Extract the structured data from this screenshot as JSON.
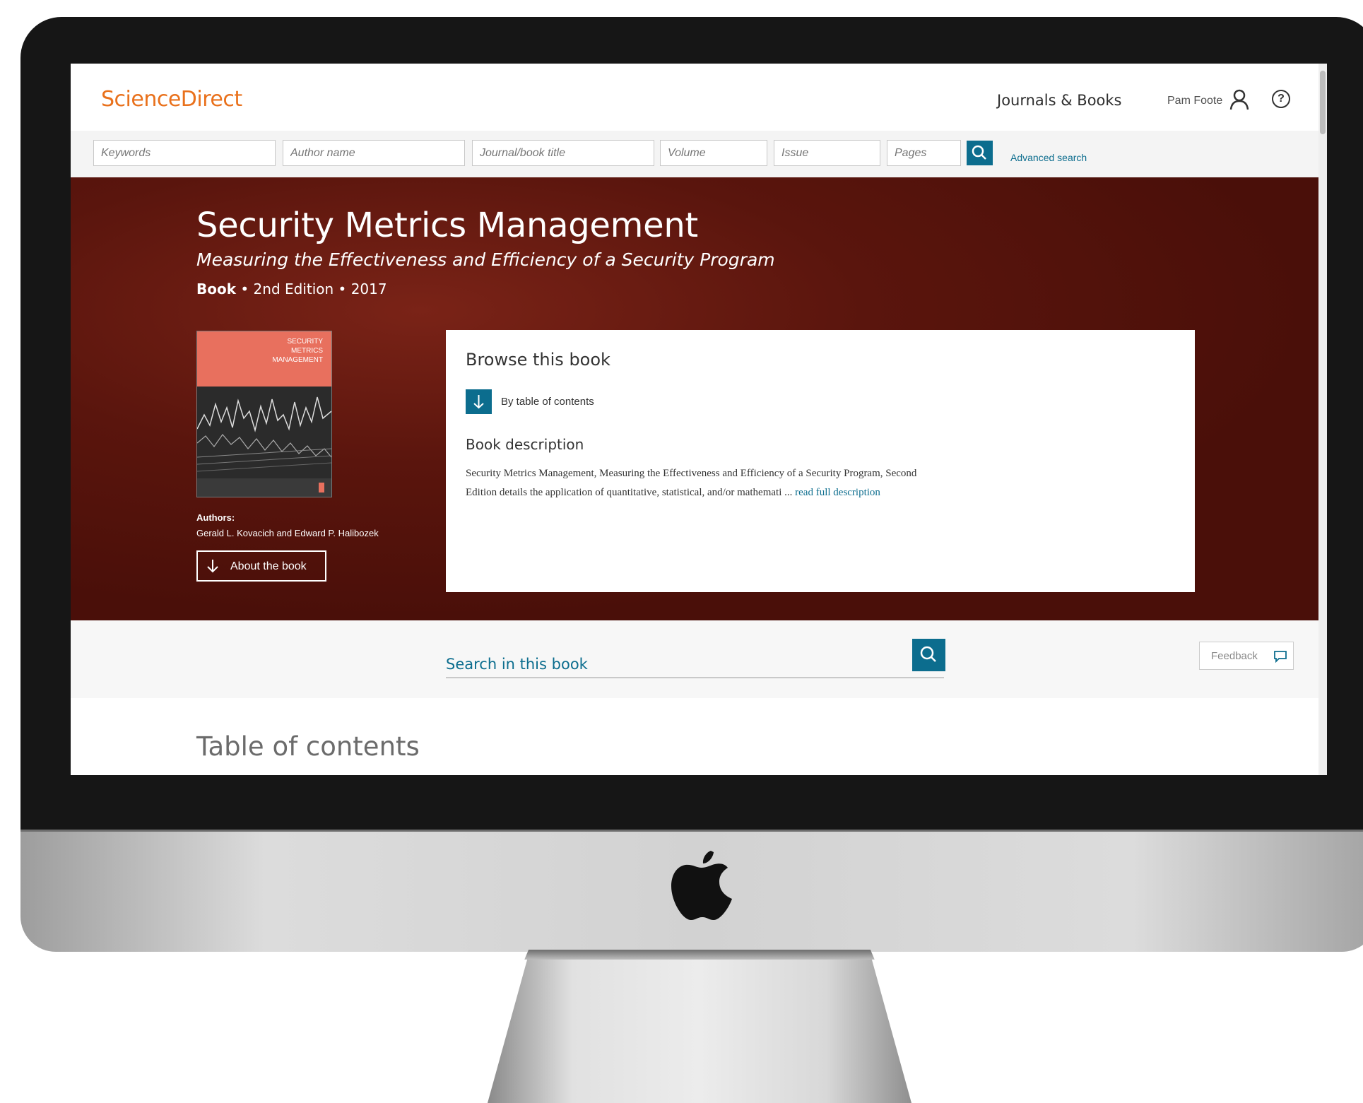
{
  "header": {
    "logo": "ScienceDirect",
    "journals_books": "Journals & Books",
    "user_name": "Pam Foote",
    "help_symbol": "?"
  },
  "search": {
    "keywords_placeholder": "Keywords",
    "author_placeholder": "Author name",
    "journal_placeholder": "Journal/book title",
    "volume_placeholder": "Volume",
    "issue_placeholder": "Issue",
    "pages_placeholder": "Pages",
    "advanced": "Advanced search"
  },
  "book": {
    "title": "Security Metrics Management",
    "subtitle": "Measuring the Effectiveness and Efficiency of a Security Program",
    "type": "Book",
    "edition_year": " • 2nd Edition • 2017",
    "cover_title_lines": [
      "SECURITY",
      "METRICS",
      "MANAGEMENT"
    ],
    "authors_label": "Authors:",
    "authors": "Gerald L. Kovacich and Edward P. Halibozek",
    "about_button": "About the book"
  },
  "browse": {
    "title": "Browse this book",
    "toc_link": "By table of contents",
    "description_title": "Book description",
    "description": "Security Metrics Management, Measuring the Effectiveness and Efficiency of a Security Program, Second Edition details the application of quantitative, statistical, and/or mathemati ... ",
    "read_more": "read full description"
  },
  "search_in_book": {
    "label": "Search in this book",
    "feedback": "Feedback"
  },
  "toc": {
    "heading": "Table of contents"
  },
  "colors": {
    "brand_orange": "#e9711c",
    "accent_blue": "#0c6d8e",
    "hero_dark_red": "#4a0f09"
  }
}
